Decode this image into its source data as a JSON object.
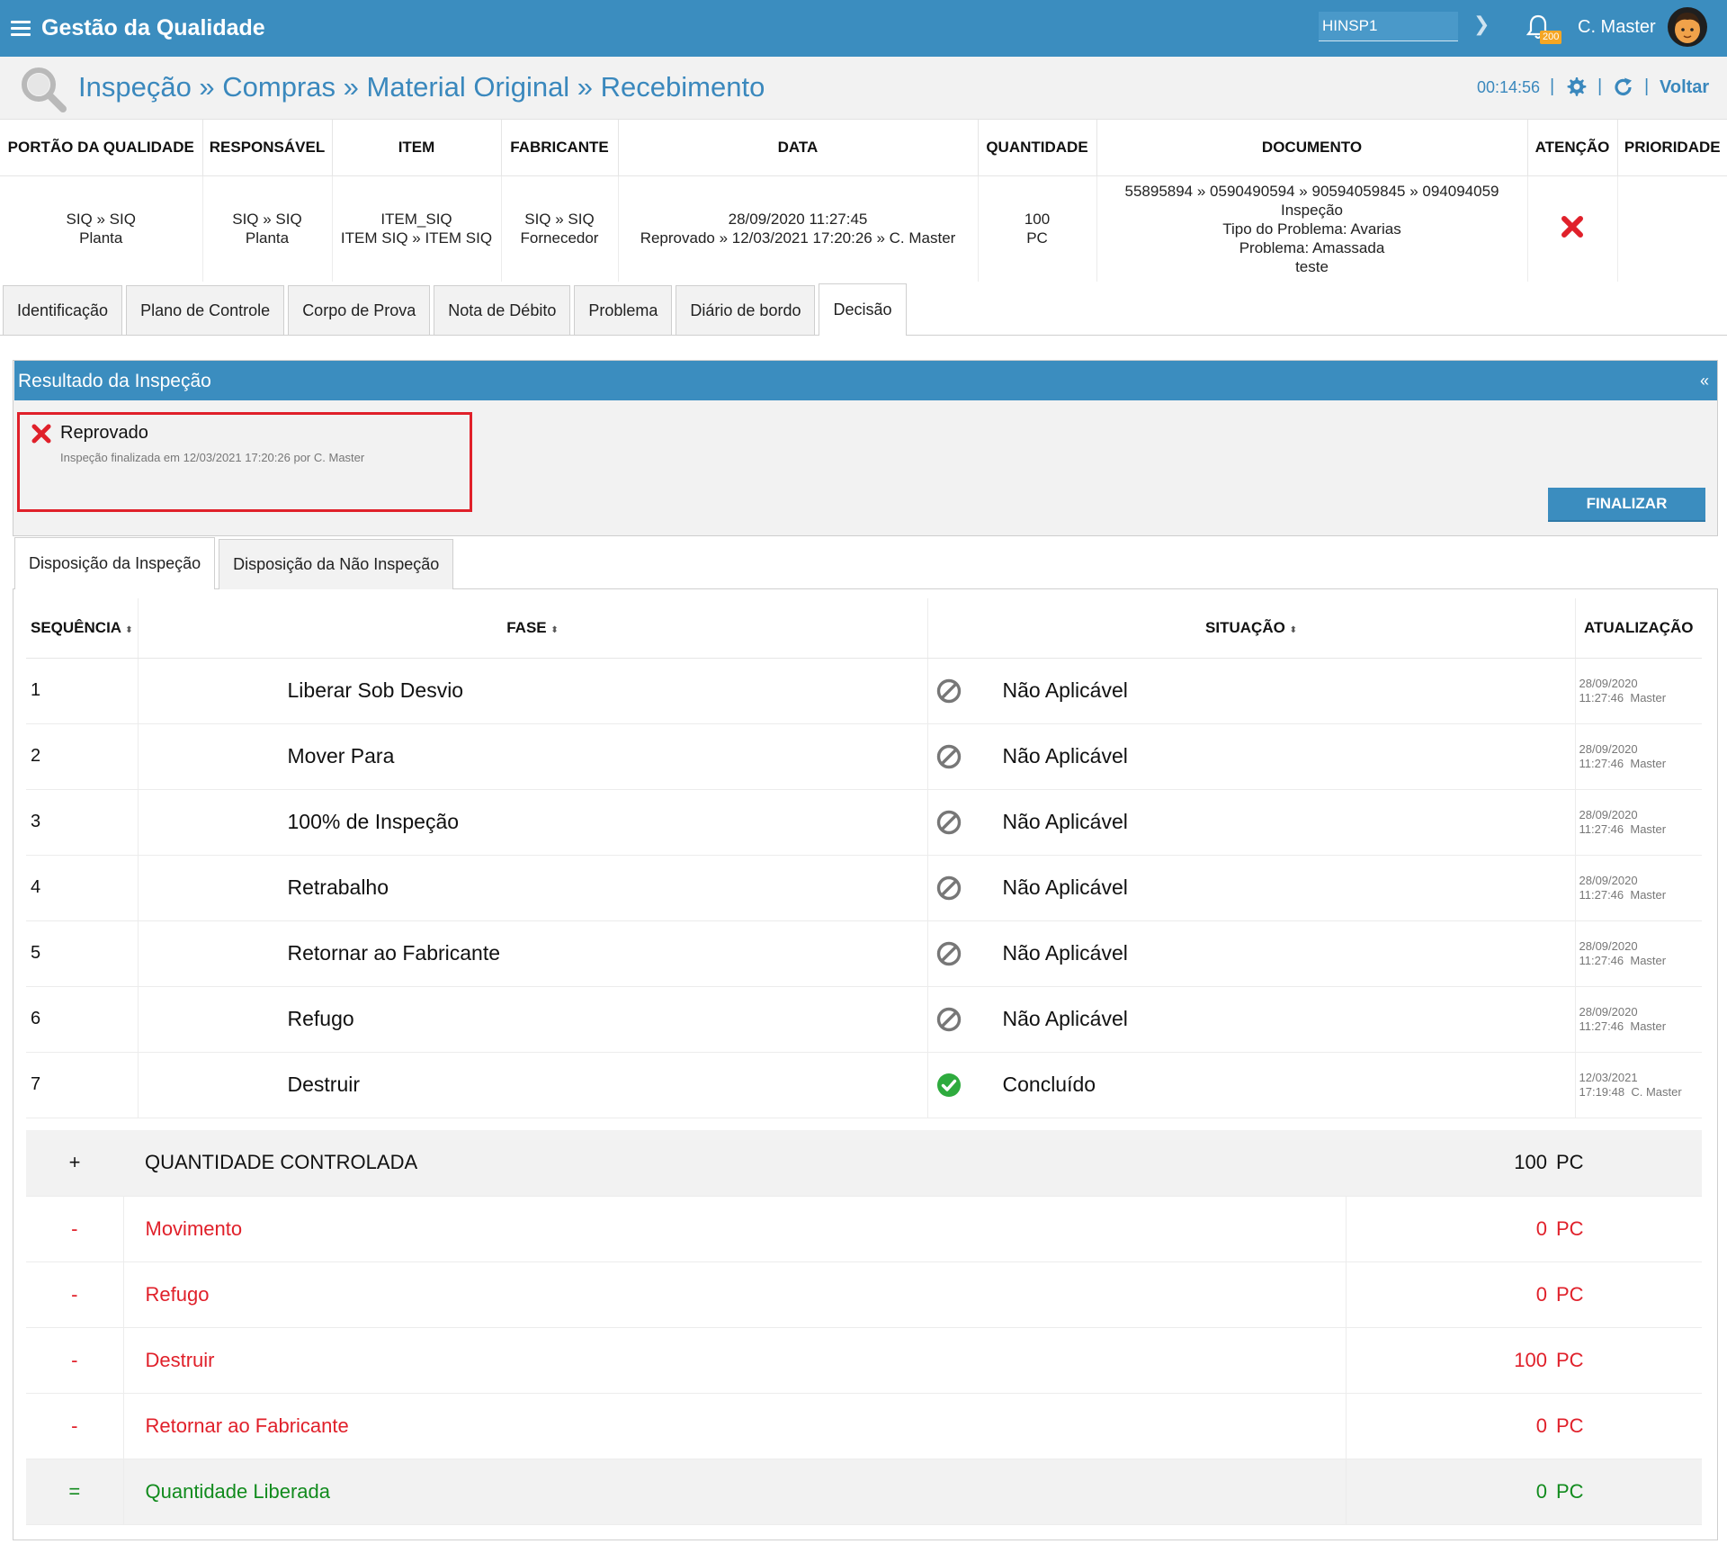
{
  "header": {
    "app_title": "Gestão da Qualidade",
    "site": "HINSP1",
    "notifications": "200",
    "user": "C. Master"
  },
  "breadcrumb": {
    "text": "Inspeção » Compras » Material Original » Recebimento",
    "timer": "00:14:56",
    "back_label": "Voltar"
  },
  "summary": {
    "columns": [
      "PORTÃO DA QUALIDADE",
      "RESPONSÁVEL",
      "ITEM",
      "FABRICANTE",
      "DATA",
      "QUANTIDADE",
      "DOCUMENTO",
      "ATENÇÃO",
      "PRIORIDADE"
    ],
    "gate": [
      "SIQ » SIQ",
      "Planta"
    ],
    "responsible": [
      "SIQ » SIQ",
      "Planta"
    ],
    "item": [
      "ITEM_SIQ",
      "ITEM SIQ » ITEM SIQ"
    ],
    "manufacturer": [
      "SIQ » SIQ",
      "Fornecedor"
    ],
    "date": [
      "28/09/2020 11:27:45",
      "Reprovado » 12/03/2021 17:20:26 » C. Master"
    ],
    "quantity": [
      "100",
      "PC"
    ],
    "document": [
      "55895894 » 0590490594 » 90594059845 » 094094059",
      "Inspeção",
      "Tipo do Problema: Avarias",
      "Problema: Amassada",
      "teste"
    ],
    "priority": ""
  },
  "tabs": [
    "Identificação",
    "Plano de Controle",
    "Corpo de Prova",
    "Nota de Débito",
    "Problema",
    "Diário de bordo",
    "Decisão"
  ],
  "active_tab": "Decisão",
  "result_panel": {
    "title": "Resultado da Inspeção",
    "collapse": "«",
    "status": "Reprovado",
    "detail": "Inspeção finalizada em 12/03/2021 17:20:26 por C. Master",
    "finalize_label": "FINALIZAR"
  },
  "subtabs": [
    "Disposição da Inspeção",
    "Disposição da Não Inspeção"
  ],
  "phase_table": {
    "columns": [
      "SEQUÊNCIA",
      "FASE",
      "SITUAÇÃO",
      "ATUALIZAÇÃO"
    ],
    "sort_glyph": "⬍",
    "rows": [
      {
        "seq": "1",
        "fase": "Liberar Sob Desvio",
        "situacao": "Não Aplicável",
        "icon": "not-applicable-icon",
        "date": "28/09/2020",
        "time": "11:27:46  Master"
      },
      {
        "seq": "2",
        "fase": "Mover Para",
        "situacao": "Não Aplicável",
        "icon": "not-applicable-icon",
        "date": "28/09/2020",
        "time": "11:27:46  Master"
      },
      {
        "seq": "3",
        "fase": "100% de Inspeção",
        "situacao": "Não Aplicável",
        "icon": "not-applicable-icon",
        "date": "28/09/2020",
        "time": "11:27:46  Master"
      },
      {
        "seq": "4",
        "fase": "Retrabalho",
        "situacao": "Não Aplicável",
        "icon": "not-applicable-icon",
        "date": "28/09/2020",
        "time": "11:27:46  Master"
      },
      {
        "seq": "5",
        "fase": "Retornar ao Fabricante",
        "situacao": "Não Aplicável",
        "icon": "not-applicable-icon",
        "date": "28/09/2020",
        "time": "11:27:46  Master"
      },
      {
        "seq": "6",
        "fase": "Refugo",
        "situacao": "Não Aplicável",
        "icon": "not-applicable-icon",
        "date": "28/09/2020",
        "time": "11:27:46  Master"
      },
      {
        "seq": "7",
        "fase": "Destruir",
        "situacao": "Concluído",
        "icon": "check-circle-icon",
        "date": "12/03/2021",
        "time": "17:19:48  C. Master"
      }
    ]
  },
  "quantities": [
    {
      "op": "+",
      "label": "QUANTIDADE CONTROLADA",
      "value": "100",
      "unit": "PC"
    },
    {
      "op": "-",
      "label": "Movimento",
      "value": "0",
      "unit": "PC"
    },
    {
      "op": "-",
      "label": "Refugo",
      "value": "0",
      "unit": "PC"
    },
    {
      "op": "-",
      "label": "Destruir",
      "value": "100",
      "unit": "PC"
    },
    {
      "op": "-",
      "label": "Retornar ao Fabricante",
      "value": "0",
      "unit": "PC"
    },
    {
      "op": "=",
      "label": "Quantidade Liberada",
      "value": "0",
      "unit": "PC"
    }
  ],
  "colors": {
    "primary": "#3b8dbf",
    "danger": "#e0202a",
    "success": "#118b1d",
    "badge": "#f5a623"
  }
}
